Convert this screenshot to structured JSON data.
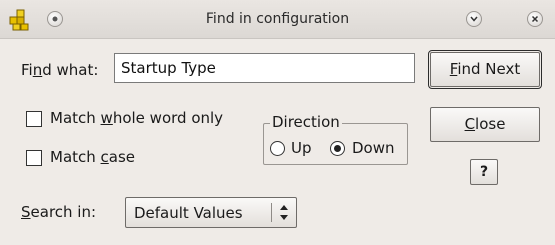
{
  "window": {
    "title": "Find in configuration"
  },
  "find": {
    "label_prefix": "Fi",
    "label_accel": "n",
    "label_suffix": "d what:",
    "value": "Startup Type"
  },
  "options": {
    "whole_word_prefix": "Match ",
    "whole_word_accel": "w",
    "whole_word_suffix": "hole word only",
    "whole_word_checked": false,
    "match_case_prefix": "Match ",
    "match_case_accel": "c",
    "match_case_suffix": "ase",
    "match_case_checked": false
  },
  "direction": {
    "title": "Direction",
    "up_label": "Up",
    "down_label": "Down",
    "selected": "Down"
  },
  "search_in": {
    "label_accel": "S",
    "label_suffix": "earch in:",
    "selected": "Default Values"
  },
  "buttons": {
    "find_next_accel": "F",
    "find_next_suffix": "ind Next",
    "close_accel": "C",
    "close_suffix": "lose",
    "help_label": "?"
  },
  "colors": {
    "window_bg": "#efebe7",
    "text": "#1a1a1a"
  }
}
